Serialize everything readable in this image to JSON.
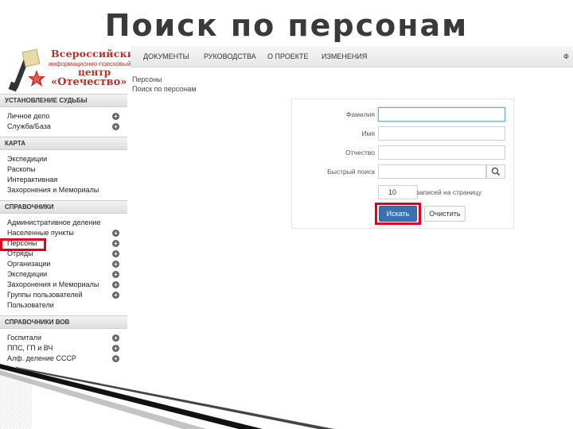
{
  "slide": {
    "title": "Поиск по персонам"
  },
  "logo": {
    "line1": "Всероссийский",
    "line2": "информационно-поисковый",
    "line3": "центр",
    "line4": "«Отечество»"
  },
  "topnav": {
    "items": [
      "Документы",
      "Руководства",
      "О проекте",
      "Изменения"
    ],
    "right_item": "Ф"
  },
  "breadcrumb": {
    "level1": "Персоны",
    "level2": "Поиск по персонам"
  },
  "sidebar": {
    "sections": [
      {
        "title": "Установление судьбы",
        "items": [
          {
            "label": "Личное дело",
            "plus": true
          },
          {
            "label": "Служба/База",
            "plus": true
          }
        ]
      },
      {
        "title": "Карта",
        "items": [
          {
            "label": "Экспедиции",
            "plus": false
          },
          {
            "label": "Раскопы",
            "plus": false
          },
          {
            "label": "Интерактивная",
            "plus": false
          },
          {
            "label": "Захоронения и Мемориалы",
            "plus": false
          }
        ]
      },
      {
        "title": "Справочники",
        "items": [
          {
            "label": "Административное деление",
            "plus": false
          },
          {
            "label": "Населенные пункты",
            "plus": true
          },
          {
            "label": "Персоны",
            "plus": true
          },
          {
            "label": "Отряды",
            "plus": true
          },
          {
            "label": "Организации",
            "plus": true
          },
          {
            "label": "Экспедиции",
            "plus": true
          },
          {
            "label": "Захоронения и Мемориалы",
            "plus": true
          },
          {
            "label": "Группы пользователей",
            "plus": true
          },
          {
            "label": "Пользователи",
            "plus": false
          }
        ]
      },
      {
        "title": "Справочники ВОВ",
        "items": [
          {
            "label": "Госпитали",
            "plus": true
          },
          {
            "label": "ППС, ГП и ВЧ",
            "plus": true
          },
          {
            "label": "Алф. деление СССР",
            "plus": true
          }
        ]
      }
    ]
  },
  "form": {
    "fields": [
      {
        "label": "Фамилия",
        "value": ""
      },
      {
        "label": "Имя",
        "value": ""
      },
      {
        "label": "Отчество",
        "value": ""
      },
      {
        "label": "Быстрый поиск",
        "value": ""
      }
    ],
    "per_page_value": "10",
    "per_page_label": "записей на страницу",
    "find_label": "Искать",
    "clear_label": "Очистить"
  },
  "colors": {
    "accent": "#3b6fb0",
    "highlight": "#e3001b",
    "logo": "#b8322a"
  }
}
